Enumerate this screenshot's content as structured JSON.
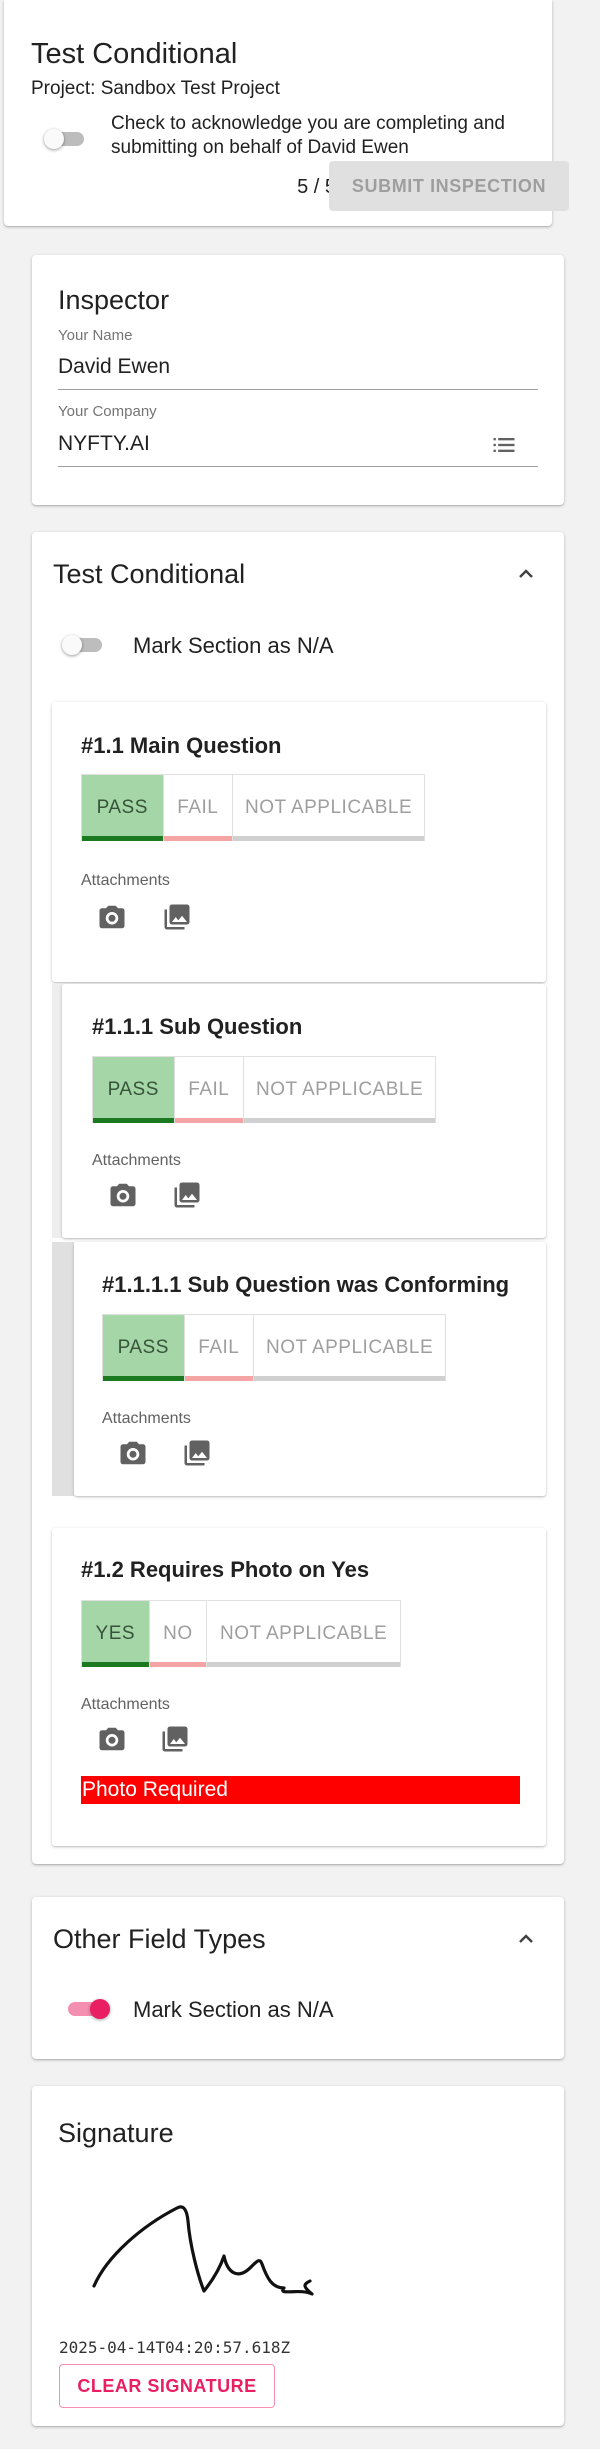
{
  "header": {
    "title": "Test Conditional",
    "project": "Project: Sandbox Test Project",
    "acknowledge_text": "Check to acknowledge you are completing and submitting on behalf of David Ewen",
    "progress": "5 / 5",
    "submit_label": "SUBMIT INSPECTION"
  },
  "inspector": {
    "title": "Inspector",
    "name_label": "Your Name",
    "name_value": "David Ewen",
    "company_label": "Your Company",
    "company_value": "NYFTY.AI"
  },
  "section1": {
    "title": "Test Conditional",
    "mark_na_label": "Mark Section as N/A",
    "mark_na_checked": false,
    "attachments_label": "Attachments",
    "questions": [
      {
        "title": "#1.1 Main Question",
        "options": [
          "PASS",
          "FAIL",
          "NOT APPLICABLE"
        ],
        "selected": "PASS"
      },
      {
        "title": "#1.1.1 Sub Question",
        "options": [
          "PASS",
          "FAIL",
          "NOT APPLICABLE"
        ],
        "selected": "PASS"
      },
      {
        "title": "#1.1.1.1 Sub Question was Conforming",
        "options": [
          "PASS",
          "FAIL",
          "NOT APPLICABLE"
        ],
        "selected": "PASS"
      },
      {
        "title": "#1.2 Requires Photo on Yes",
        "options": [
          "YES",
          "NO",
          "NOT APPLICABLE"
        ],
        "selected": "YES",
        "warning": "Photo Required"
      }
    ]
  },
  "section2": {
    "title": "Other Field Types",
    "mark_na_label": "Mark Section as N/A",
    "mark_na_checked": true
  },
  "signature": {
    "title": "Signature",
    "timestamp": "2025-04-14T04:20:57.618Z",
    "clear_label": "CLEAR SIGNATURE"
  },
  "colors": {
    "pass_bg": "#a5d6a7",
    "pass_bar": "#1b7a1f",
    "fail_bar": "#f5a4a4",
    "warning_bg": "#ff0000",
    "accent_pink": "#e91e63"
  },
  "icons": [
    "camera-icon",
    "image-icon",
    "list-icon",
    "chevron-up-icon"
  ]
}
